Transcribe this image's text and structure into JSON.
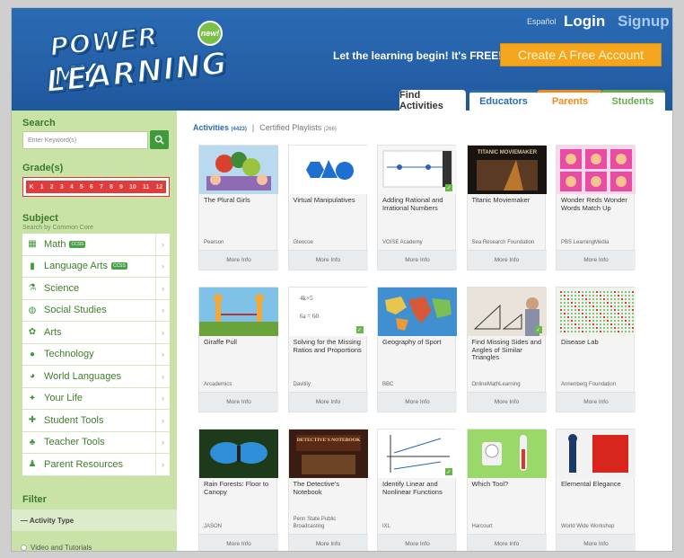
{
  "header": {
    "logo_line1": "POWER MY",
    "logo_line2": "LEARNING",
    "new_badge": "new!",
    "lang": "Español",
    "login": "Login",
    "signup": "Signup",
    "tagline": "Let the learning begin! It's FREE!",
    "cta": "Create A Free Account",
    "tabs": [
      {
        "label": "Find Activities"
      },
      {
        "label": "Educators"
      },
      {
        "label": "Parents"
      },
      {
        "label": "Students"
      }
    ]
  },
  "sidebar": {
    "search_label": "Search",
    "search_placeholder": "Enter Keyword(s)",
    "grades_label": "Grade(s)",
    "grades": [
      "K",
      "1",
      "2",
      "3",
      "4",
      "5",
      "6",
      "7",
      "8",
      "9",
      "10",
      "11",
      "12"
    ],
    "subject_label": "Subject",
    "subject_sub": "Search by Common Core",
    "ccss_badge": "CCSS",
    "subjects": [
      {
        "label": "Math",
        "icon": "math-icon"
      },
      {
        "label": "Language Arts",
        "icon": "book-icon"
      },
      {
        "label": "Science",
        "icon": "flask-icon"
      },
      {
        "label": "Social Studies",
        "icon": "globe-icon"
      },
      {
        "label": "Arts",
        "icon": "palette-icon"
      },
      {
        "label": "Technology",
        "icon": "lightbulb-icon"
      },
      {
        "label": "World Languages",
        "icon": "chat-icon"
      },
      {
        "label": "Your Life",
        "icon": "star-icon"
      },
      {
        "label": "Student Tools",
        "icon": "tools-icon"
      },
      {
        "label": "Teacher Tools",
        "icon": "apple-icon"
      },
      {
        "label": "Parent Resources",
        "icon": "family-icon"
      }
    ],
    "filter_label": "Filter",
    "activity_type": "— Activity Type",
    "video_option": "Video and Tutorials"
  },
  "main": {
    "activities_label": "Activities",
    "activities_count": "(4423)",
    "separator": "|",
    "playlists_label": "Certified Playlists",
    "playlists_count": "(266)",
    "more_info": "More Info",
    "cards": [
      {
        "title": "The Plural Girls",
        "publisher": "Pearson"
      },
      {
        "title": "Virtual Manipulatives",
        "publisher": "Glencoe"
      },
      {
        "title": "Adding Rational and Irrational Numbers",
        "publisher": "VOISE Academy"
      },
      {
        "title": "Titanic Moviemaker",
        "publisher": "Sea Research Foundation",
        "thumb_text": "TITANIC MOVIEMAKER"
      },
      {
        "title": "Wonder Reds Wonder Words Match Up",
        "publisher": "PBS LearningMedia"
      },
      {
        "title": "Giraffe Pull",
        "publisher": "Arcademics"
      },
      {
        "title": "Solving for the Missing Ratios and Proportions",
        "publisher": "Davitily",
        "thumb_text": "6a = 60"
      },
      {
        "title": "Geography of Sport",
        "publisher": "BBC"
      },
      {
        "title": "Find Missing Sides and Angles of Similar Triangles",
        "publisher": "OnlineMathLearning"
      },
      {
        "title": "Disease Lab",
        "publisher": "Annenberg Foundation"
      },
      {
        "title": "Rain Forests: Floor to Canopy",
        "publisher": "JASON"
      },
      {
        "title": "The Detective's Notebook",
        "publisher": "Penn State Public Broadcasting",
        "thumb_text": "DETECTIVE'S NOTEBOOK"
      },
      {
        "title": "Identify Linear and Nonlinear Functions",
        "publisher": "IXL"
      },
      {
        "title": "Which Tool?",
        "publisher": "Harcourt"
      },
      {
        "title": "Elemental Elegance",
        "publisher": "World Wide Workshop"
      }
    ]
  }
}
